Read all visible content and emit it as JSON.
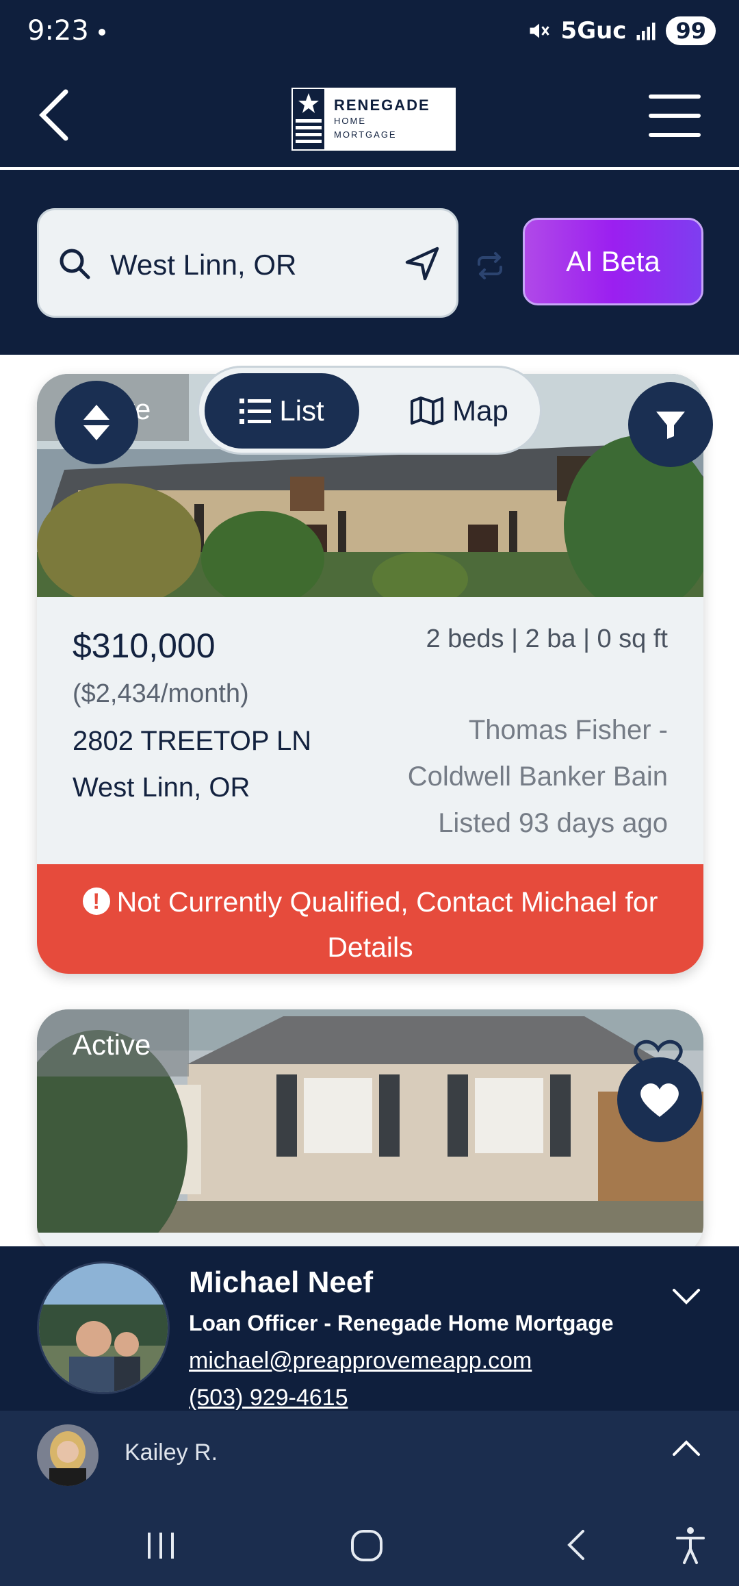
{
  "status_bar": {
    "time": "9:23",
    "network": "5Guc",
    "battery": "99"
  },
  "header": {
    "logo_big": "RENEGADE",
    "logo_line2": "HOME",
    "logo_line3": "MORTGAGE"
  },
  "search": {
    "value": "West Linn, OR",
    "ai_button": "AI Beta"
  },
  "view_toggle": {
    "list_label": "List",
    "map_label": "Map"
  },
  "listings": [
    {
      "status": "Active",
      "price": "$310,000",
      "monthly": "($2,434/month)",
      "address_line1": "2802 TREETOP LN",
      "address_line2": "West Linn, OR",
      "specs": "2 beds | 2 ba | 0 sq ft",
      "agent": "Thomas Fisher -",
      "brokerage": "Coldwell Banker Bain",
      "listed": "Listed 93 days ago",
      "alert": "Not Currently Qualified, Contact Michael for Details"
    },
    {
      "status": "Active"
    }
  ],
  "loan_officer": {
    "name": "Michael Neef",
    "role": "Loan Officer - Renegade Home Mortgage",
    "email": "michael@preapprovemeapp.com",
    "phone": "(503) 929-4615"
  },
  "contact_bar": {
    "name": "Kailey R."
  },
  "colors": {
    "navy": "#0f1f3d",
    "alert_red": "#e64b3c",
    "ai_purple": "#9b1ff0"
  },
  "icons": [
    "back-icon",
    "menu-icon",
    "search-icon",
    "navigation-icon",
    "repeat-icon",
    "sort-icon",
    "list-icon",
    "map-icon",
    "filter-icon",
    "heart-icon",
    "chevron-down-icon",
    "chevron-up-icon"
  ]
}
